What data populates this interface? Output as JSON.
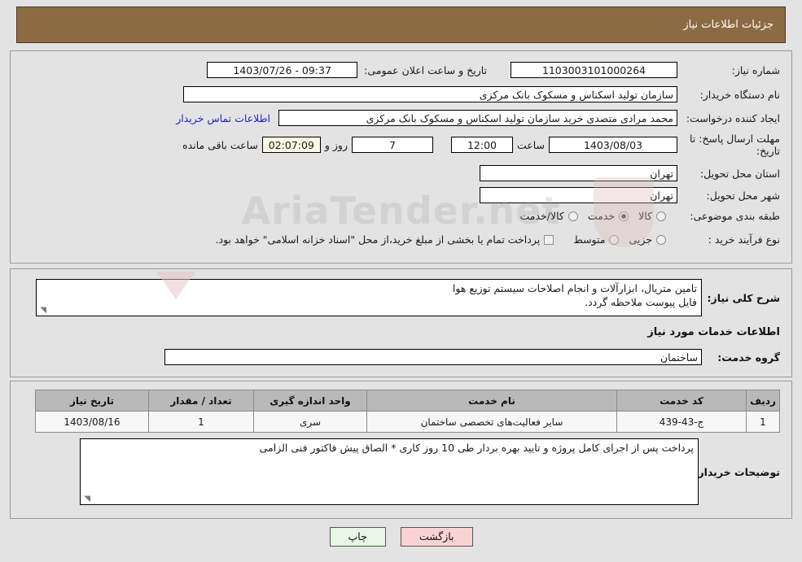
{
  "header": {
    "title": "جزئیات اطلاعات نیاز"
  },
  "form": {
    "need_number_label": "شماره نیاز:",
    "need_number_value": "1103003101000264",
    "announce_label": "تاریخ و ساعت اعلان عمومی:",
    "announce_value": "09:37 - 1403/07/26",
    "buyer_org_label": "نام دستگاه خریدار:",
    "buyer_org_value": "سازمان تولید اسکناس و مسکوک بانک مرکزی",
    "requester_label": "ایجاد کننده درخواست:",
    "requester_value": "محمد مرادی متصدی خرید سازمان تولید اسکناس و مسکوک بانک مرکزی",
    "contact_link": "اطلاعات تماس خریدار",
    "deadline_label": "مهلت ارسال پاسخ: تا تاریخ:",
    "deadline_date": "1403/08/03",
    "time_label": "ساعت",
    "deadline_time": "12:00",
    "days_value": "7",
    "days_label": "روز و",
    "countdown_value": "02:07:09",
    "countdown_label": "ساعت باقی مانده",
    "province_label": "استان محل تحویل:",
    "province_value": "تهران",
    "city_label": "شهر محل تحویل:",
    "city_value": "تهران",
    "category_label": "طبقه بندی موضوعی:",
    "category_options": [
      "کالا",
      "خدمت",
      "کالا/خدمت"
    ],
    "category_selected": "خدمت",
    "process_label": "نوع فرآیند خرید :",
    "process_options": [
      "جزیی",
      "متوسط"
    ],
    "treasury_note": "پرداخت تمام یا بخشی از مبلغ خرید،از محل \"اسناد خزانه اسلامی\" خواهد بود."
  },
  "description": {
    "label": "شرح کلی نیاز:",
    "line1": "تامین متریال، ابزارآلات و انجام اصلاحات سیستم توزیع هوا",
    "line2": "فایل پیوست ملاحظه گردد."
  },
  "services": {
    "section_title": "اطلاعات خدمات مورد نیاز",
    "group_label": "گروه خدمت:",
    "group_value": "ساختمان",
    "columns": [
      "ردیف",
      "کد خدمت",
      "نام خدمت",
      "واحد اندازه گیری",
      "تعداد / مقدار",
      "تاریخ نیاز"
    ],
    "rows": [
      {
        "radif": "1",
        "code": "ج-43-439",
        "name": "سایر فعالیت‌های تخصصی ساختمان",
        "unit": "سری",
        "quantity": "1",
        "need_date": "1403/08/16"
      }
    ]
  },
  "buyer_notes": {
    "label": "توضیحات خریدار:",
    "text": "پرداخت پس از اجرای کامل پروژه و تایید بهره بردار طی 10 روز کاری * الصاق پیش فاکتور فنی الزامی"
  },
  "buttons": {
    "back": "بازگشت",
    "print": "چاپ"
  },
  "watermark": {
    "text": "AriaTender.net"
  },
  "colors": {
    "header_bg": "#8c6b43",
    "link": "#2222cc",
    "back_btn": "#f9d3d3",
    "print_btn": "#e6f7e3",
    "countdown_bg": "#fbfbe4",
    "table_header_bg": "#b9b9b9"
  }
}
